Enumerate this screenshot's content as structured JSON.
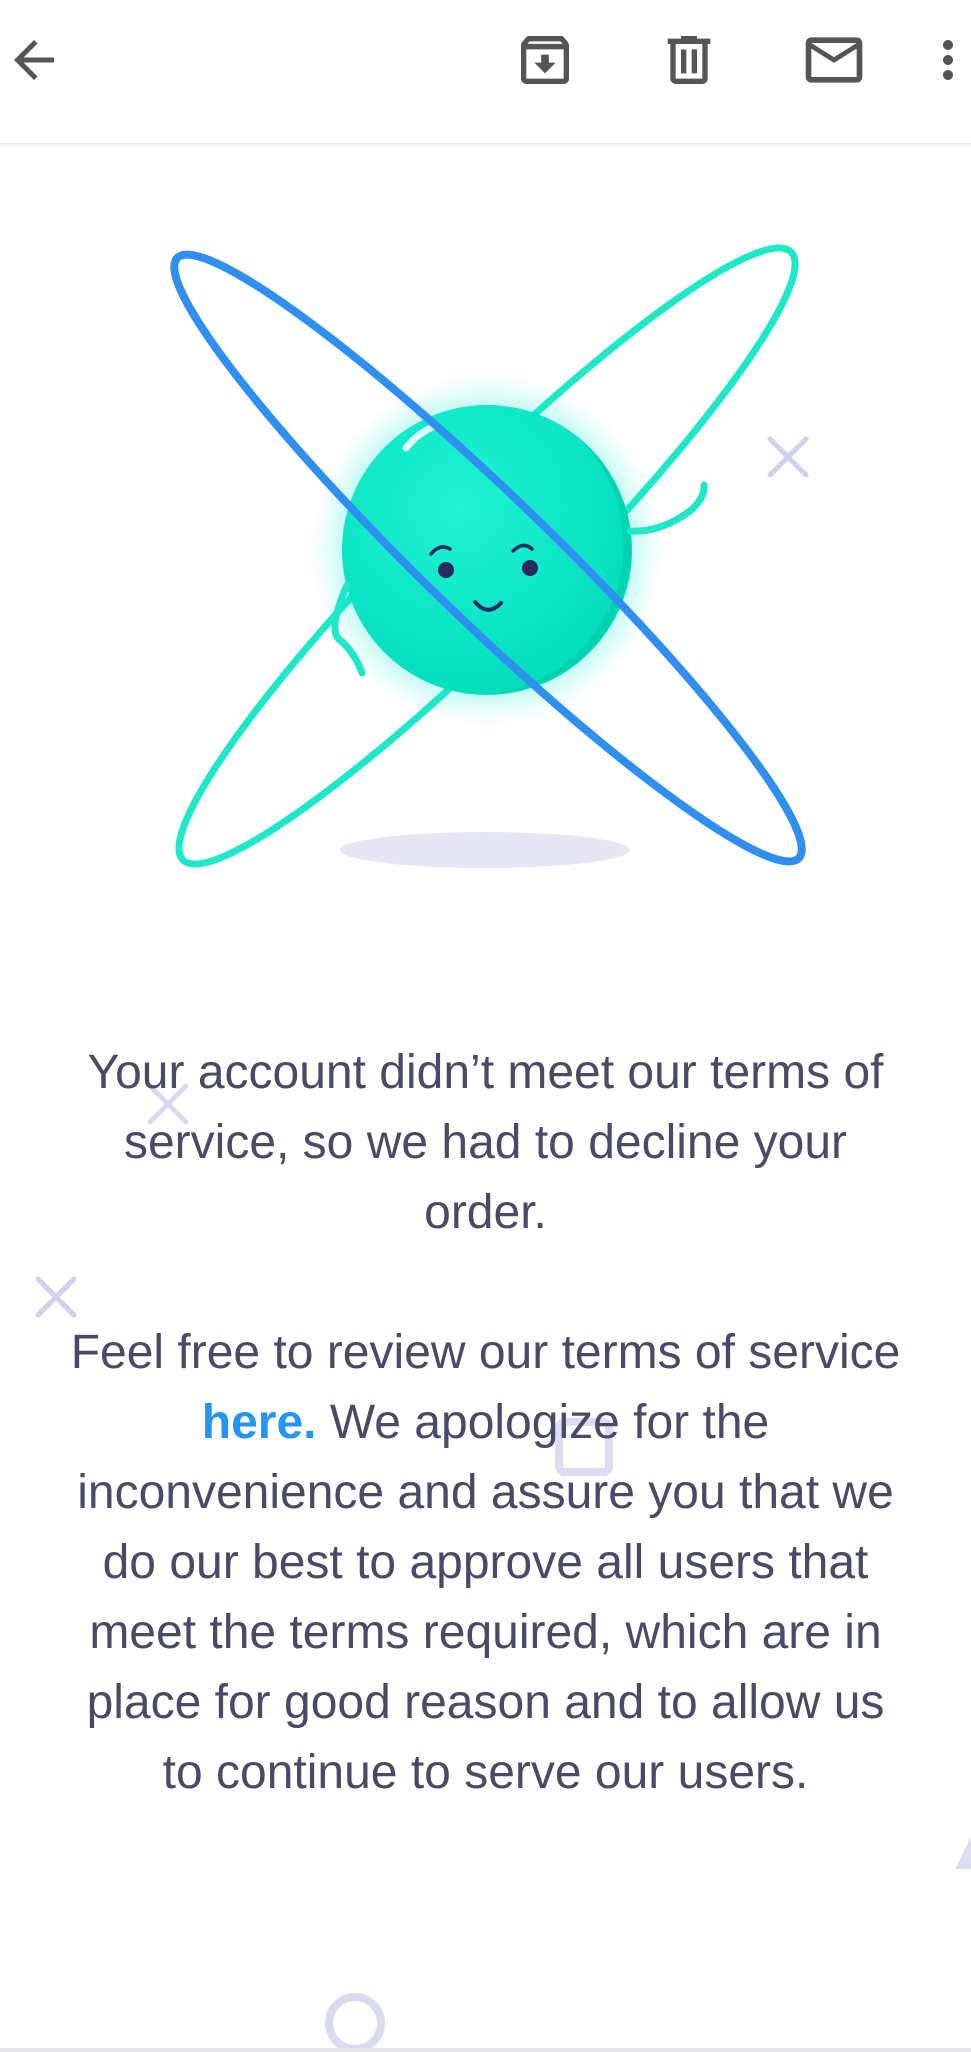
{
  "toolbar": {
    "icons": [
      "back-arrow-icon",
      "archive-icon",
      "trash-icon",
      "mail-icon",
      "more-vert-icon"
    ]
  },
  "message": {
    "paragraph1": "Your account didn’t meet our terms of service, so we had to decline your order.",
    "paragraph2_before": "Feel free to review our terms of service ",
    "link_text": "here.",
    "paragraph2_after": " We apologize for the inconvenience and assure you that we do our best to approve all users that meet the terms required, which are in place for good reason and to allow us to continue to serve our users."
  },
  "colors": {
    "text": "#4a4a68",
    "link": "#2196f3",
    "orbit_blue": "#2e8ff0",
    "orbit_teal": "#1de9c8",
    "ball": "#00e8c6",
    "decoration": "#cfd0ec"
  }
}
